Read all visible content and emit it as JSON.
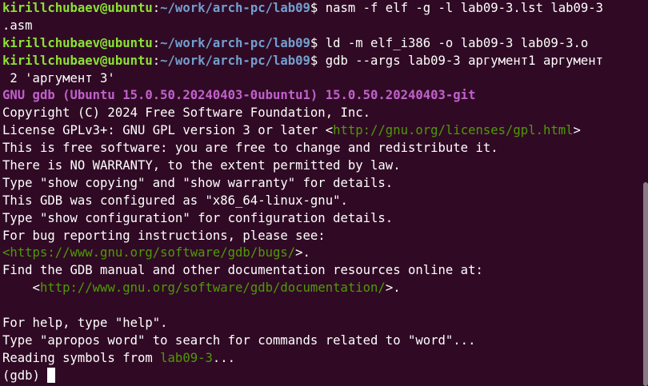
{
  "prompt": {
    "user_host": "kirillchubaev@ubuntu",
    "path": "~/work/arch-pc/lab09",
    "symbol": "$"
  },
  "commands": [
    {
      "text": " nasm -f elf -g -l lab09-3.lst lab09-3",
      "cont": ".asm"
    },
    {
      "text": " ld -m elf_i386 -o lab09-3 lab09-3.o"
    },
    {
      "text": " gdb --args lab09-3 аргумент1 аргумент",
      "cont": " 2 'аргумент 3'"
    }
  ],
  "gdb": {
    "banner": "GNU gdb (Ubuntu 15.0.50.20240403-0ubuntu1) 15.0.50.20240403-git",
    "copyright": "Copyright (C) 2024 Free Software Foundation, Inc.",
    "license_pre": "License GPLv3+: GNU GPL version 3 or later <",
    "license_url": "http://gnu.org/licenses/gpl.html",
    "license_post": ">",
    "free_sw": "This is free software: you are free to change and redistribute it.",
    "warranty": "There is NO WARRANTY, to the extent permitted by law.",
    "show_copying": "Type \"show copying\" and \"show warranty\" for details.",
    "configured": "This GDB was configured as \"x86_64-linux-gnu\".",
    "show_config": "Type \"show configuration\" for configuration details.",
    "bug_reporting": "For bug reporting instructions, please see:",
    "bugs_pre": "<",
    "bugs_url": "https://www.gnu.org/software/gdb/bugs/",
    "bugs_post": ">.",
    "manual": "Find the GDB manual and other documentation resources online at:",
    "doc_pre": "    <",
    "doc_url": "http://www.gnu.org/software/gdb/documentation/",
    "doc_post": ">.",
    "help": "For help, type \"help\".",
    "apropos": "Type \"apropos word\" to search for commands related to \"word\"...",
    "reading_pre": "Reading symbols from ",
    "reading_file": "lab09-3",
    "reading_post": "...",
    "gdb_prompt": "(gdb) "
  }
}
